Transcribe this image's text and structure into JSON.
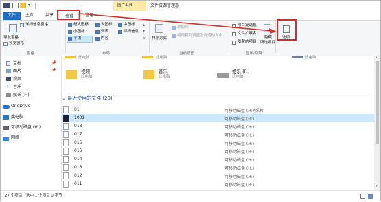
{
  "titlebar": {
    "tools_tab": "图片工具",
    "window_title": "文件资源管理器"
  },
  "tabs": [
    {
      "label": "文件"
    },
    {
      "label": "主页"
    },
    {
      "label": "共享"
    },
    {
      "label": "查看"
    },
    {
      "label": "管理"
    }
  ],
  "ribbon": {
    "panes": {
      "nav_pane": "导航窗格",
      "preview_pane": "预览窗格",
      "details_pane": "详细信息窗格",
      "group": "窗格"
    },
    "layout": {
      "xl_icons": "超大图标",
      "large_icons": "大图标",
      "medium_icons": "中图标",
      "small_icons": "小图标",
      "list": "列表",
      "details": "详细信息",
      "tiles": "平铺",
      "content": "内容",
      "group": "布局"
    },
    "current_view": {
      "sort_by": "排序方式",
      "add_column": "添加列",
      "size_all": "将所有列调整为合适的大小",
      "group": "当前视图"
    },
    "show_hide": {
      "item_checkbox": "项目复选框",
      "file_ext": "文件扩展名",
      "hidden_items": "隐藏的项目",
      "hide": "隐藏",
      "hide_selected": "所选项目",
      "group": "显示/隐藏"
    },
    "options": "选项"
  },
  "nav": {
    "items": [
      {
        "label": "文档"
      },
      {
        "label": "图片"
      },
      {
        "label": "视频"
      },
      {
        "label": "音乐"
      },
      {
        "label": "娱乐 (F:)"
      },
      {
        "label": "OneDrive"
      },
      {
        "label": "此电脑"
      },
      {
        "label": "可移动磁盘 (H:)"
      },
      {
        "label": "网络"
      }
    ]
  },
  "main": {
    "top_partial": [
      {
        "label": "此电脑"
      },
      {
        "label": "此电脑"
      },
      {
        "label": "此电脑"
      }
    ],
    "folders": [
      {
        "name": "视频",
        "sub": "此电脑"
      },
      {
        "name": "音乐",
        "sub": "此电脑"
      },
      {
        "name": "娱乐 (F:)",
        "sub": "此电脑"
      }
    ],
    "recent_header": "最近使用的文件 (20)",
    "files": [
      {
        "name": "01",
        "location": "可移动磁盘 (H:)\\照片"
      },
      {
        "name": "1001",
        "location": "可移动磁盘 (H:)"
      },
      {
        "name": "018",
        "location": "可移动磁盘 (H:)"
      },
      {
        "name": "017",
        "location": "可移动磁盘 (H:)"
      },
      {
        "name": "016",
        "location": "可移动磁盘 (H:)"
      },
      {
        "name": "015",
        "location": "可移动磁盘 (H:)"
      },
      {
        "name": "014",
        "location": "可移动磁盘 (H:)"
      },
      {
        "name": "013",
        "location": "可移动磁盘 (H:)"
      },
      {
        "name": "012",
        "location": "可移动磁盘 (H:)"
      },
      {
        "name": "011",
        "location": "可移动磁盘 (H:)"
      }
    ]
  },
  "status": {
    "count": "27 个项目",
    "selected": "选中 1 个项目  0 字节"
  },
  "colors": {
    "file_tab": "#1e6fc8",
    "tools_tab": "#fbe9a8",
    "highlight": "#d0302c",
    "selected_row": "#cce8ff"
  }
}
